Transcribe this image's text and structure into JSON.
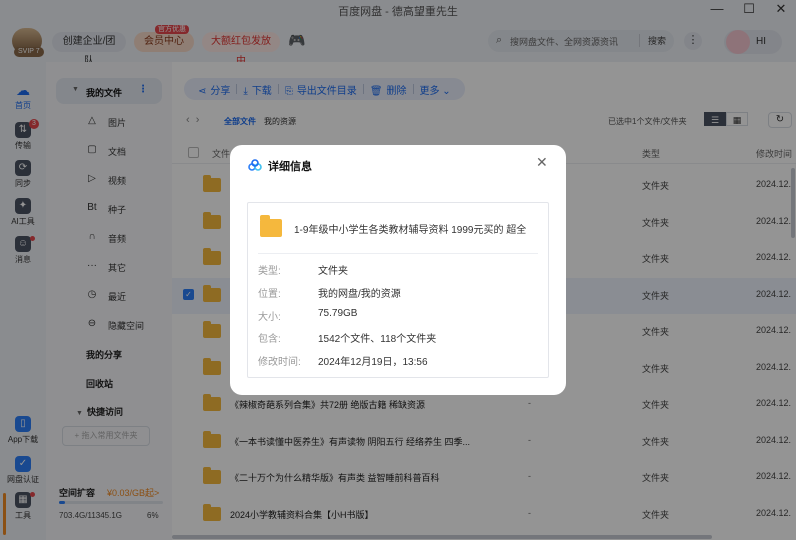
{
  "window": {
    "title": "百度网盘 - 德高望重先生"
  },
  "header": {
    "svip_badge": "SVIP 7",
    "team_button": "创建企业/团队",
    "vip_button": "会员中心",
    "vip_badge": "官方优惠",
    "red_envelope_button": "大额红包发放中",
    "search_placeholder": "搜网盘文件、全网资源资讯",
    "search_button": "搜索",
    "greeting": "HI"
  },
  "rail": {
    "items": [
      {
        "label": "首页"
      },
      {
        "label": "传输",
        "badge": "3"
      },
      {
        "label": "同步"
      },
      {
        "label": "AI工具"
      },
      {
        "label": "消息"
      },
      {
        "label": "App下载"
      },
      {
        "label": "网盘认证"
      },
      {
        "label": "工具"
      }
    ]
  },
  "sidebar": {
    "my_files": "我的文件",
    "categories": [
      {
        "icon": "△",
        "label": "图片"
      },
      {
        "icon": "▢",
        "label": "文档"
      },
      {
        "icon": "▷",
        "label": "视频"
      },
      {
        "icon": "Bt",
        "label": "种子"
      },
      {
        "icon": "∩",
        "label": "音频"
      },
      {
        "icon": "···",
        "label": "其它"
      },
      {
        "icon": "◷",
        "label": "最近"
      },
      {
        "icon": "⊖",
        "label": "隐藏空间"
      }
    ],
    "my_share": "我的分享",
    "recycle": "回收站",
    "quick_access": "快捷访问",
    "add_quick": "+ 拖入常用文件夹",
    "quota": {
      "label": "空间扩容",
      "price": "¥0.03/GB起>",
      "used": "703.4G/11345.1G",
      "percent": "6%",
      "fraction": 0.06
    }
  },
  "toolbar": {
    "share": "分享",
    "download": "下载",
    "export": "导出文件目录",
    "delete": "删除",
    "more": "更多"
  },
  "breadcrumb": {
    "root": "全部文件",
    "current": "我的资源",
    "selection": "已选中1个文件/文件夹"
  },
  "table": {
    "col_name": "文件",
    "col_type": "类型",
    "col_date": "修改时间",
    "rows": [
      {
        "name": "",
        "size": "",
        "type": "文件夹",
        "date": "2024.12.",
        "selected": false
      },
      {
        "name": "",
        "size": "",
        "type": "文件夹",
        "date": "2024.12.",
        "selected": false
      },
      {
        "name": "",
        "size": "",
        "type": "文件夹",
        "date": "2024.12.",
        "selected": false
      },
      {
        "name": "",
        "size": "",
        "type": "文件夹",
        "date": "2024.12.",
        "selected": true
      },
      {
        "name": "",
        "size": "",
        "type": "文件夹",
        "date": "2024.12.",
        "selected": false
      },
      {
        "name": "",
        "size": "",
        "type": "文件夹",
        "date": "2024.12.",
        "selected": false
      },
      {
        "name": "《辣椒奇葩系列合集》共72册 绝版古籍 稀缺资源",
        "size": "-",
        "type": "文件夹",
        "date": "2024.12.",
        "selected": false
      },
      {
        "name": "《一本书读懂中医养生》有声读物 阴阳五行 经络养生 四季...",
        "size": "-",
        "type": "文件夹",
        "date": "2024.12.",
        "selected": false
      },
      {
        "name": "《二十万个为什么精华版》有声类 益智睡前科普百科",
        "size": "-",
        "type": "文件夹",
        "date": "2024.12.",
        "selected": false
      },
      {
        "name": "2024小学教辅资料合集【小H书版】",
        "size": "-",
        "type": "文件夹",
        "date": "2024.12.",
        "selected": false
      }
    ]
  },
  "modal": {
    "title": "详细信息",
    "file_name": "1-9年级中小学生各类教材辅导资料 1999元买的 超全",
    "fields": [
      {
        "label": "类型:",
        "value": "文件夹"
      },
      {
        "label": "位置:",
        "value": "我的网盘/我的资源"
      },
      {
        "label": "大小:",
        "value": "75.79GB"
      },
      {
        "label": "包含:",
        "value": "1542个文件、118个文件夹"
      },
      {
        "label": "修改时间:",
        "value": "2024年12月19日，13:56"
      }
    ]
  }
}
